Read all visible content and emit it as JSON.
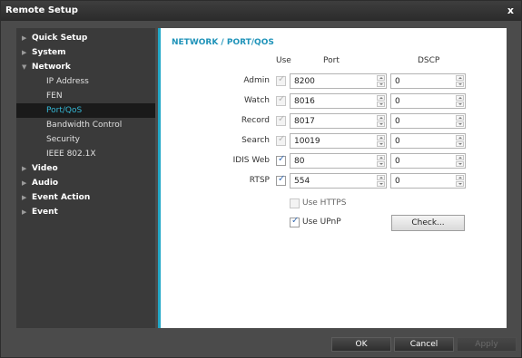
{
  "window": {
    "title": "Remote Setup"
  },
  "sidebar": {
    "items": [
      {
        "label": "Quick Setup",
        "level": "top",
        "expanded": false
      },
      {
        "label": "System",
        "level": "top",
        "expanded": false
      },
      {
        "label": "Network",
        "level": "top",
        "expanded": true
      },
      {
        "label": "IP Address",
        "level": "sub"
      },
      {
        "label": "FEN",
        "level": "sub"
      },
      {
        "label": "Port/QoS",
        "level": "sub",
        "selected": true
      },
      {
        "label": "Bandwidth Control",
        "level": "sub"
      },
      {
        "label": "Security",
        "level": "sub"
      },
      {
        "label": "IEEE 802.1X",
        "level": "sub"
      },
      {
        "label": "Video",
        "level": "top",
        "expanded": false
      },
      {
        "label": "Audio",
        "level": "top",
        "expanded": false
      },
      {
        "label": "Event Action",
        "level": "top",
        "expanded": false
      },
      {
        "label": "Event",
        "level": "top",
        "expanded": false
      }
    ]
  },
  "main": {
    "title": "NETWORK / PORT/QOS",
    "headers": {
      "use": "Use",
      "port": "Port",
      "dscp": "DSCP"
    },
    "rows": [
      {
        "label": "Admin",
        "use_checked": true,
        "use_enabled": false,
        "port": "8200",
        "dscp": "0"
      },
      {
        "label": "Watch",
        "use_checked": true,
        "use_enabled": false,
        "port": "8016",
        "dscp": "0"
      },
      {
        "label": "Record",
        "use_checked": true,
        "use_enabled": false,
        "port": "8017",
        "dscp": "0"
      },
      {
        "label": "Search",
        "use_checked": true,
        "use_enabled": false,
        "port": "10019",
        "dscp": "0"
      },
      {
        "label": "IDIS Web",
        "use_checked": true,
        "use_enabled": true,
        "port": "80",
        "dscp": "0"
      },
      {
        "label": "RTSP",
        "use_checked": true,
        "use_enabled": true,
        "port": "554",
        "dscp": "0"
      }
    ],
    "use_https": {
      "label": "Use HTTPS",
      "checked": false,
      "enabled": false
    },
    "use_upnp": {
      "label": "Use UPnP",
      "checked": true,
      "enabled": true
    },
    "check_button": "Check..."
  },
  "footer": {
    "ok": "OK",
    "cancel": "Cancel",
    "apply": "Apply"
  },
  "colors": {
    "accent": "#22a8c8",
    "title_accent": "#1f93b9",
    "selected_text": "#36b8d6"
  }
}
